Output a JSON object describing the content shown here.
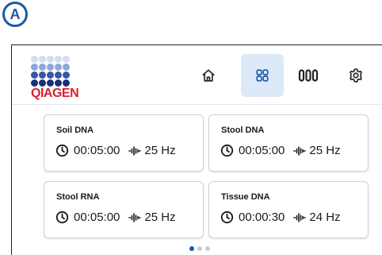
{
  "figure": {
    "panel_label": "A"
  },
  "brand": {
    "name": "QIAGEN",
    "dot_colors": [
      "#d3dcf0",
      "#d3dcf0",
      "#d3dcf0",
      "#d3dcf0",
      "#d3dcf0",
      "#8fa6d8",
      "#8fa6d8",
      "#8fa6d8",
      "#8fa6d8",
      "#8fa6d8",
      "#3557a8",
      "#3557a8",
      "#3557a8",
      "#3557a8",
      "#3557a8",
      "#1a2f78",
      "#1a2f78",
      "#1a2f78",
      "#1a2f78",
      "#1a2f78"
    ]
  },
  "nav": {
    "items": [
      {
        "icon": "home-icon",
        "active": false
      },
      {
        "icon": "grid-icon",
        "active": true
      },
      {
        "icon": "tubes-icon",
        "active": false
      },
      {
        "icon": "gear-icon",
        "active": false
      }
    ],
    "active_color": "#dce9f8",
    "accent": "#1b5aa8"
  },
  "protocols": [
    {
      "name": "Soil DNA",
      "time": "00:05:00",
      "frequency": "25 Hz"
    },
    {
      "name": "Stool DNA",
      "time": "00:05:00",
      "frequency": "25 Hz"
    },
    {
      "name": "Stool RNA",
      "time": "00:05:00",
      "frequency": "25 Hz"
    },
    {
      "name": "Tissue DNA",
      "time": "00:00:30",
      "frequency": "24 Hz"
    }
  ],
  "pager": {
    "pages": 3,
    "current": 1,
    "active_color": "#1b5aa8",
    "inactive_color": "#c8ccd2"
  }
}
